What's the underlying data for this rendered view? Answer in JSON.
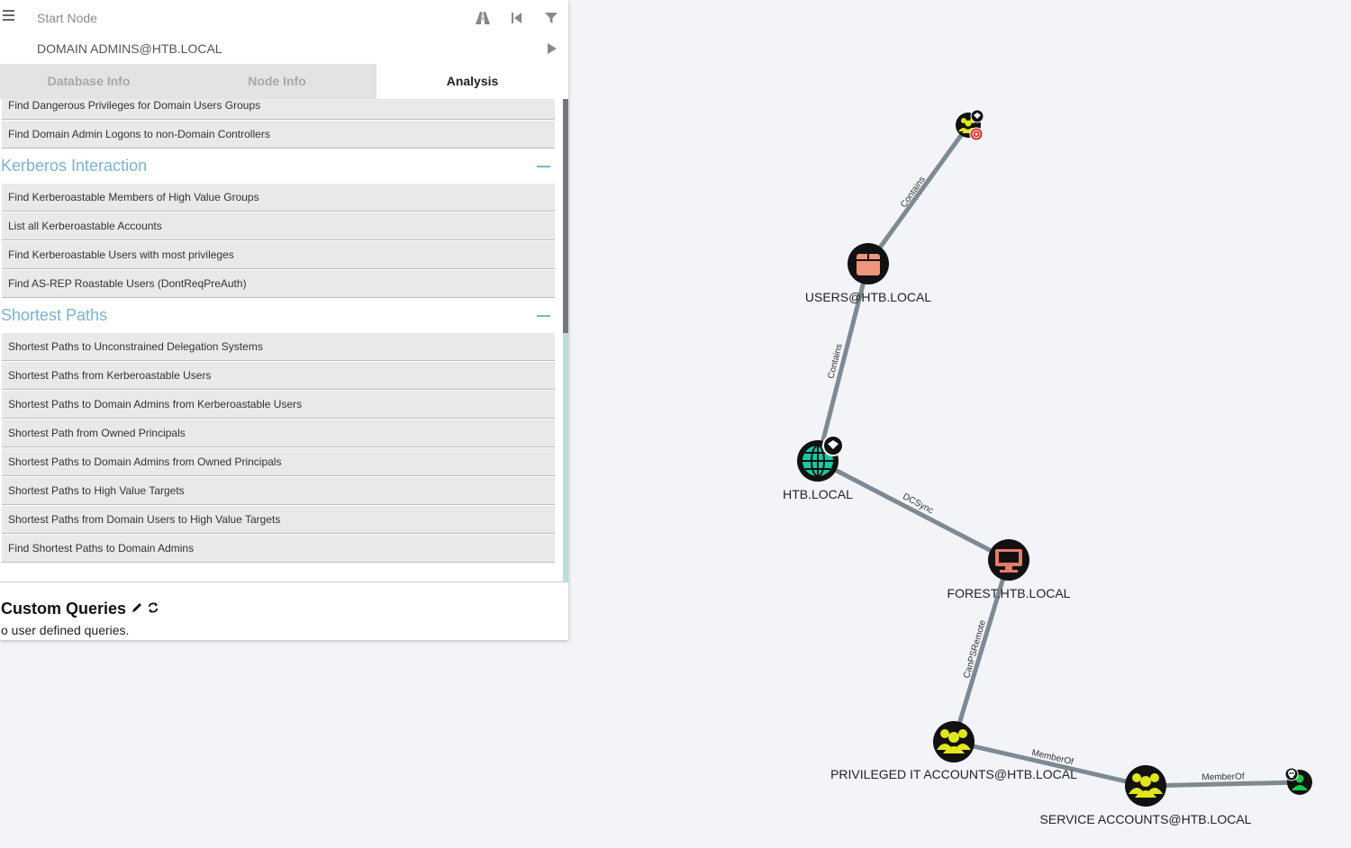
{
  "search": {
    "start_placeholder": "Start Node",
    "target_value": "DOMAIN ADMINS@HTB.LOCAL"
  },
  "tabs": [
    {
      "label": "Database Info",
      "active": false
    },
    {
      "label": "Node Info",
      "active": false
    },
    {
      "label": "Analysis",
      "active": true
    }
  ],
  "queries_top": [
    "Find Dangerous Privileges for Domain Users Groups",
    "Find Domain Admin Logons to non-Domain Controllers"
  ],
  "sections": [
    {
      "title": "Kerberos Interaction",
      "items": [
        "Find Kerberoastable Members of High Value Groups",
        "List all Kerberoastable Accounts",
        "Find Kerberoastable Users with most privileges",
        "Find AS-REP Roastable Users (DontReqPreAuth)"
      ]
    },
    {
      "title": "Shortest Paths",
      "items": [
        "Shortest Paths to Unconstrained Delegation Systems",
        "Shortest Paths from Kerberoastable Users",
        "Shortest Paths to Domain Admins from Kerberoastable Users",
        "Shortest Path from Owned Principals",
        "Shortest Paths to Domain Admins from Owned Principals",
        "Shortest Paths to High Value Targets",
        "Shortest Paths from Domain Users to High Value Targets",
        "Find Shortest Paths to Domain Admins"
      ]
    }
  ],
  "custom_queries": {
    "title": "Custom Queries",
    "empty_text": "o user defined queries."
  },
  "graph": {
    "nodes": {
      "domain_admins": {
        "label": "",
        "icon": "group-icon"
      },
      "users_ou": {
        "label": "USERS@HTB.LOCAL",
        "icon": "ou-box-icon"
      },
      "domain": {
        "label": "HTB.LOCAL",
        "icon": "globe-icon"
      },
      "forest": {
        "label": "FOREST.HTB.LOCAL",
        "icon": "computer-icon"
      },
      "privileged_it": {
        "label": "PRIVILEGED IT ACCOUNTS@HTB.LOCAL",
        "icon": "group-icon"
      },
      "service_accounts": {
        "label": "SERVICE ACCOUNTS@HTB.LOCAL",
        "icon": "group-icon"
      },
      "user": {
        "label": "",
        "icon": "user-icon"
      }
    },
    "edges": [
      {
        "label": "Contains"
      },
      {
        "label": "Contains"
      },
      {
        "label": "DCSync"
      },
      {
        "label": "CanPSRemote"
      },
      {
        "label": "MemberOf"
      },
      {
        "label": "MemberOf"
      }
    ],
    "colors": {
      "group": "#e1e61c",
      "ou": "#f0957b",
      "domain": "#19c9a5",
      "computer": "#e77a6b",
      "user": "#18c94a",
      "node_bg": "#111111",
      "edge": "#7d8a93",
      "high_value": "#d92f2f"
    }
  }
}
